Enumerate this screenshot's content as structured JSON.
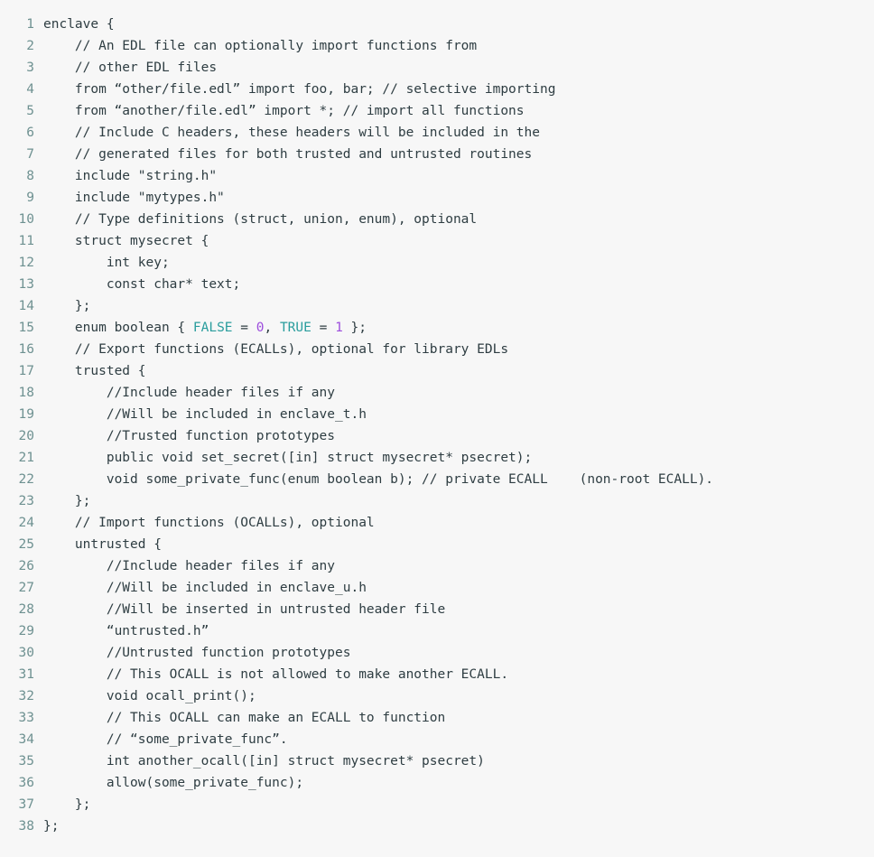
{
  "listing": {
    "language": "edl",
    "background_color": "#f7f7f7",
    "text_color": "#2e3d42",
    "line_number_color": "#6e9191",
    "constant_color": "#2a9d9d",
    "number_color": "#9d4edd",
    "total_lines": 38,
    "lines": [
      {
        "number": "1",
        "text": "enclave {"
      },
      {
        "number": "2",
        "text": "    // An EDL file can optionally import functions from"
      },
      {
        "number": "3",
        "text": "    // other EDL files"
      },
      {
        "number": "4",
        "text": "    from “other/file.edl” import foo, bar; // selective importing"
      },
      {
        "number": "5",
        "text": "    from “another/file.edl” import *; // import all functions"
      },
      {
        "number": "6",
        "text": "    // Include C headers, these headers will be included in the"
      },
      {
        "number": "7",
        "text": "    // generated files for both trusted and untrusted routines"
      },
      {
        "number": "8",
        "text": "    include \"string.h\""
      },
      {
        "number": "9",
        "text": "    include \"mytypes.h\""
      },
      {
        "number": "10",
        "text": "    // Type definitions (struct, union, enum), optional"
      },
      {
        "number": "11",
        "text": "    struct mysecret {"
      },
      {
        "number": "12",
        "text": "        int key;"
      },
      {
        "number": "13",
        "text": "        const char* text;"
      },
      {
        "number": "14",
        "text": "    };"
      },
      {
        "number": "15",
        "segments": [
          {
            "text": "    enum boolean { ",
            "style": "plain"
          },
          {
            "text": "FALSE",
            "style": "const"
          },
          {
            "text": " = ",
            "style": "plain"
          },
          {
            "text": "0",
            "style": "num"
          },
          {
            "text": ", ",
            "style": "plain"
          },
          {
            "text": "TRUE",
            "style": "const"
          },
          {
            "text": " = ",
            "style": "plain"
          },
          {
            "text": "1",
            "style": "num"
          },
          {
            "text": " };",
            "style": "plain"
          }
        ]
      },
      {
        "number": "16",
        "text": "    // Export functions (ECALLs), optional for library EDLs"
      },
      {
        "number": "17",
        "text": "    trusted {"
      },
      {
        "number": "18",
        "text": "        //Include header files if any"
      },
      {
        "number": "19",
        "text": "        //Will be included in enclave_t.h"
      },
      {
        "number": "20",
        "text": "        //Trusted function prototypes"
      },
      {
        "number": "21",
        "text": "        public void set_secret([in] struct mysecret* psecret);"
      },
      {
        "number": "22",
        "text": "        void some_private_func(enum boolean b); // private ECALL    (non-root ECALL)."
      },
      {
        "number": "23",
        "text": "    };"
      },
      {
        "number": "24",
        "text": "    // Import functions (OCALLs), optional"
      },
      {
        "number": "25",
        "text": "    untrusted {"
      },
      {
        "number": "26",
        "text": "        //Include header files if any"
      },
      {
        "number": "27",
        "text": "        //Will be included in enclave_u.h"
      },
      {
        "number": "28",
        "text": "        //Will be inserted in untrusted header file"
      },
      {
        "number": "29",
        "text": "        “untrusted.h”"
      },
      {
        "number": "30",
        "text": "        //Untrusted function prototypes"
      },
      {
        "number": "31",
        "text": "        // This OCALL is not allowed to make another ECALL."
      },
      {
        "number": "32",
        "text": "        void ocall_print();"
      },
      {
        "number": "33",
        "text": "        // This OCALL can make an ECALL to function"
      },
      {
        "number": "34",
        "text": "        // “some_private_func”."
      },
      {
        "number": "35",
        "text": "        int another_ocall([in] struct mysecret* psecret)"
      },
      {
        "number": "36",
        "text": "        allow(some_private_func);"
      },
      {
        "number": "37",
        "text": "    };"
      },
      {
        "number": "38",
        "text": "};"
      }
    ]
  }
}
